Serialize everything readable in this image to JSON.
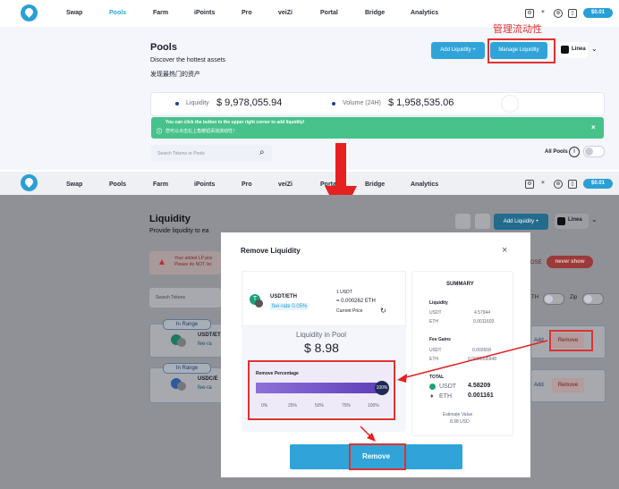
{
  "nav": {
    "items": [
      "Swap",
      "Pools",
      "Farm",
      "iPoints",
      "Pro",
      "veiZi",
      "Portal",
      "Bridge",
      "Analytics"
    ],
    "price": "$0.01"
  },
  "annotation": {
    "manage_label_cn": "管理流动性"
  },
  "pools": {
    "title": "Pools",
    "subtitle": "Discover the hottest assets",
    "subtitle_cn": "发现最热门的资产",
    "add_liquidity": "Add Liquidity +",
    "manage_liquidity": "Manage Liquidity",
    "network": "Linea",
    "liquidity_label": "Liquidity",
    "liquidity_value": "$ 9,978,055.94",
    "volume_label": "Volume (24H)",
    "volume_value": "$ 1,958,535.06",
    "banner_en": "You can click the button in the upper right corner to add liquidity!",
    "banner_cn": "您可以点击右上角按钮添加流动性！",
    "search_placeholder": "Search Tokens or Pools",
    "all_pools": "All Pools"
  },
  "liquidity": {
    "title": "Liquidity",
    "subtitle": "Provide liquidity to ea",
    "add_liquidity": "Add Liquidity +",
    "network": "Linea",
    "warn_line1": "Your added LP pos",
    "warn_line2": "Please do NOT loc",
    "close_label": "OSE",
    "never_show": "never show",
    "search_placeholder": "Search Tokens",
    "toggle1": "TH",
    "toggle2": "Zip",
    "rows": [
      {
        "status": "In Range",
        "pair": "USDT/ET",
        "fee": "fee-ra",
        "add": "Add",
        "remove": "Remove"
      },
      {
        "status": "In Range",
        "pair": "USDC/E",
        "fee": "fee-ra",
        "add": "Add",
        "remove": "Remove"
      }
    ]
  },
  "modal": {
    "title": "Remove Liquidity",
    "close": "×",
    "pair": "USDT/ETH",
    "fee_rate": "fee-rate 0.05%",
    "rate_line1": "1 USDT",
    "rate_line2": "= 0.000262 ETH",
    "current_price": "Current Price",
    "pool_label": "Liquidity in Pool",
    "pool_value": "$ 8.98",
    "remove_pct_label": "Remove Percentage",
    "pct_value": "100%",
    "pct_fill": 1.0,
    "ticks": [
      "0%",
      "25%",
      "50%",
      "75%",
      "100%"
    ],
    "remove_button": "Remove",
    "summary": {
      "title": "SUMMARY",
      "liquidity_label": "Liquidity",
      "liq_rows": [
        {
          "t": "USDT",
          "v": "4.57944"
        },
        {
          "t": "ETH",
          "v": "0.0011603"
        }
      ],
      "fee_label": "Fee Gains",
      "fee_rows": [
        {
          "t": "USDT",
          "v": "0.002658"
        },
        {
          "t": "ETH",
          "v": "0.0000006948"
        }
      ],
      "total_label": "TOTAL",
      "total_rows": [
        {
          "t": "USDT",
          "v": "4.58209"
        },
        {
          "t": "ETH",
          "v": "0.001161"
        }
      ],
      "estimate_label": "Estimate Value",
      "estimate_value": "8.98 USD"
    }
  },
  "colors": {
    "accent": "#30a4d8",
    "red": "#e03131",
    "green": "#47c28a",
    "purple": "#6b4fc7"
  }
}
